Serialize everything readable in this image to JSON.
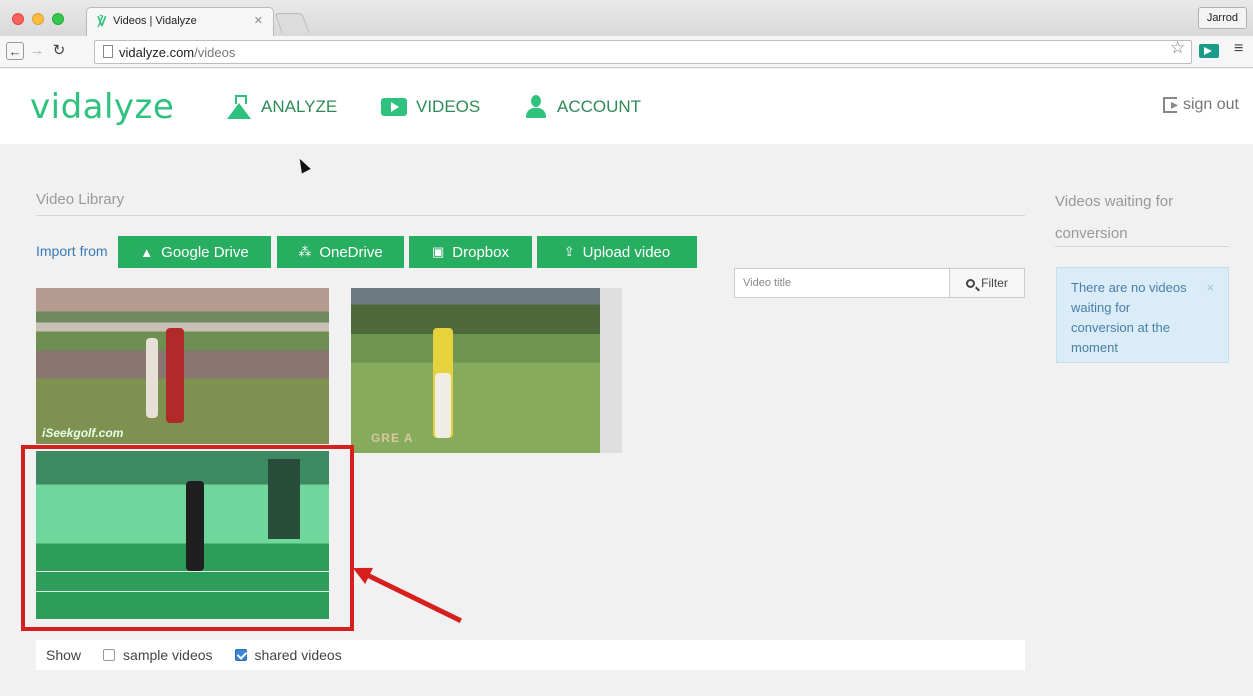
{
  "browser": {
    "tab_title": "Videos | Vidalyze",
    "user": "Jarrod",
    "url_host": "vidalyze.com",
    "url_path": "/videos"
  },
  "header": {
    "logo": "vidalyze",
    "nav": [
      {
        "label": "ANALYZE",
        "icon": "flask-icon"
      },
      {
        "label": "VIDEOS",
        "icon": "play-icon"
      },
      {
        "label": "ACCOUNT",
        "icon": "user-icon"
      }
    ],
    "sign_out": "sign out"
  },
  "library": {
    "title": "Video Library",
    "import_label": "Import from",
    "buttons": [
      {
        "label": "Google Drive",
        "icon": "google-drive-icon"
      },
      {
        "label": "OneDrive",
        "icon": "onedrive-icon"
      },
      {
        "label": "Dropbox",
        "icon": "dropbox-icon"
      },
      {
        "label": "Upload video",
        "icon": "upload-icon"
      }
    ],
    "filter": {
      "placeholder": "Video title",
      "button": "Filter"
    },
    "thumbnails": [
      {
        "watermark": "iSeekgolf.com"
      },
      {
        "watermark": "GRE A"
      },
      {
        "watermark": ""
      }
    ],
    "show": {
      "label": "Show",
      "options": [
        {
          "label": "sample videos",
          "checked": false
        },
        {
          "label": "shared videos",
          "checked": true
        }
      ]
    }
  },
  "conversion": {
    "title": "Videos waiting for conversion",
    "message": "There are no videos waiting for conversion at the moment",
    "close": "×"
  },
  "colors": {
    "brand_green": "#2ec27e",
    "button_green": "#27ae60",
    "highlight_red": "#d61f1f",
    "alert_bg": "#d9ecf7"
  }
}
